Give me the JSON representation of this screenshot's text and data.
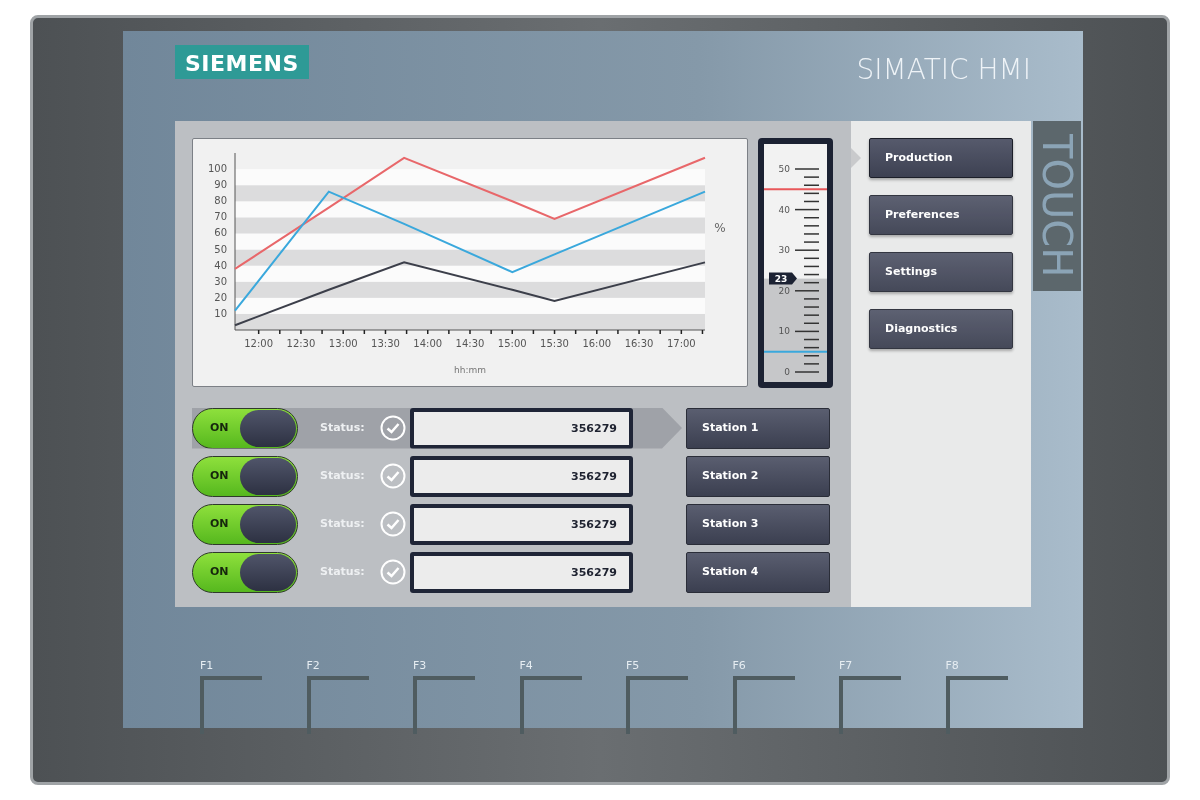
{
  "device": {
    "brand": "SIEMENS",
    "model": "SIMATIC HMI",
    "side_label": "TOUCH"
  },
  "chart": {
    "chart_data": {
      "type": "line",
      "xlabel": "hh:mm",
      "ylabel": "%",
      "x": [
        11.72,
        12.83,
        13.72,
        15.0,
        15.5,
        17.28
      ],
      "series": [
        {
          "color": "#e8676a",
          "values": [
            38,
            76,
            107,
            80,
            69,
            107
          ]
        },
        {
          "color": "#3aa8dc",
          "values": [
            12,
            86,
            66,
            36,
            47,
            86
          ]
        },
        {
          "color": "#3c3f4a",
          "values": [
            3,
            25,
            42,
            25,
            18,
            42
          ]
        }
      ],
      "xlim": [
        11.72,
        17.28
      ],
      "ylim": [
        0,
        110
      ],
      "xticks": [
        {
          "value": 12,
          "label": "12:00"
        },
        {
          "value": 12.5,
          "label": "12:30"
        },
        {
          "value": 13,
          "label": "13:00"
        },
        {
          "value": 13.5,
          "label": "13:30"
        },
        {
          "value": 14,
          "label": "14:00"
        },
        {
          "value": 14.5,
          "label": "14:30"
        },
        {
          "value": 15,
          "label": "15:00"
        },
        {
          "value": 15.5,
          "label": "15:30"
        },
        {
          "value": 16,
          "label": "16:00"
        },
        {
          "value": 16.5,
          "label": "16:30"
        },
        {
          "value": 17,
          "label": "17:00"
        }
      ],
      "yticks": [
        10,
        20,
        30,
        40,
        50,
        60,
        70,
        80,
        90,
        100
      ]
    }
  },
  "gauge": {
    "scale_labels": [
      "50",
      "40",
      "30",
      "20",
      "10",
      "0"
    ],
    "level": 0.46,
    "reading": "23"
  },
  "stations": [
    {
      "toggle": "ON",
      "on": true,
      "status_label": "Status:",
      "value": "356279",
      "button": "Station 1",
      "selected": true
    },
    {
      "toggle": "ON",
      "on": true,
      "status_label": "Status:",
      "value": "356279",
      "button": "Station 2",
      "selected": false
    },
    {
      "toggle": "ON",
      "on": true,
      "status_label": "Status:",
      "value": "356279",
      "button": "Station 3",
      "selected": false
    },
    {
      "toggle": "ON",
      "on": true,
      "status_label": "Status:",
      "value": "356279",
      "button": "Station 4",
      "selected": false
    }
  ],
  "menu": [
    {
      "label": "Production",
      "selected": true
    },
    {
      "label": "Preferences",
      "selected": false
    },
    {
      "label": "Settings",
      "selected": false
    },
    {
      "label": "Diagnostics",
      "selected": false
    }
  ],
  "function_keys": [
    "F1",
    "F2",
    "F3",
    "F4",
    "F5",
    "F6",
    "F7",
    "F8"
  ]
}
